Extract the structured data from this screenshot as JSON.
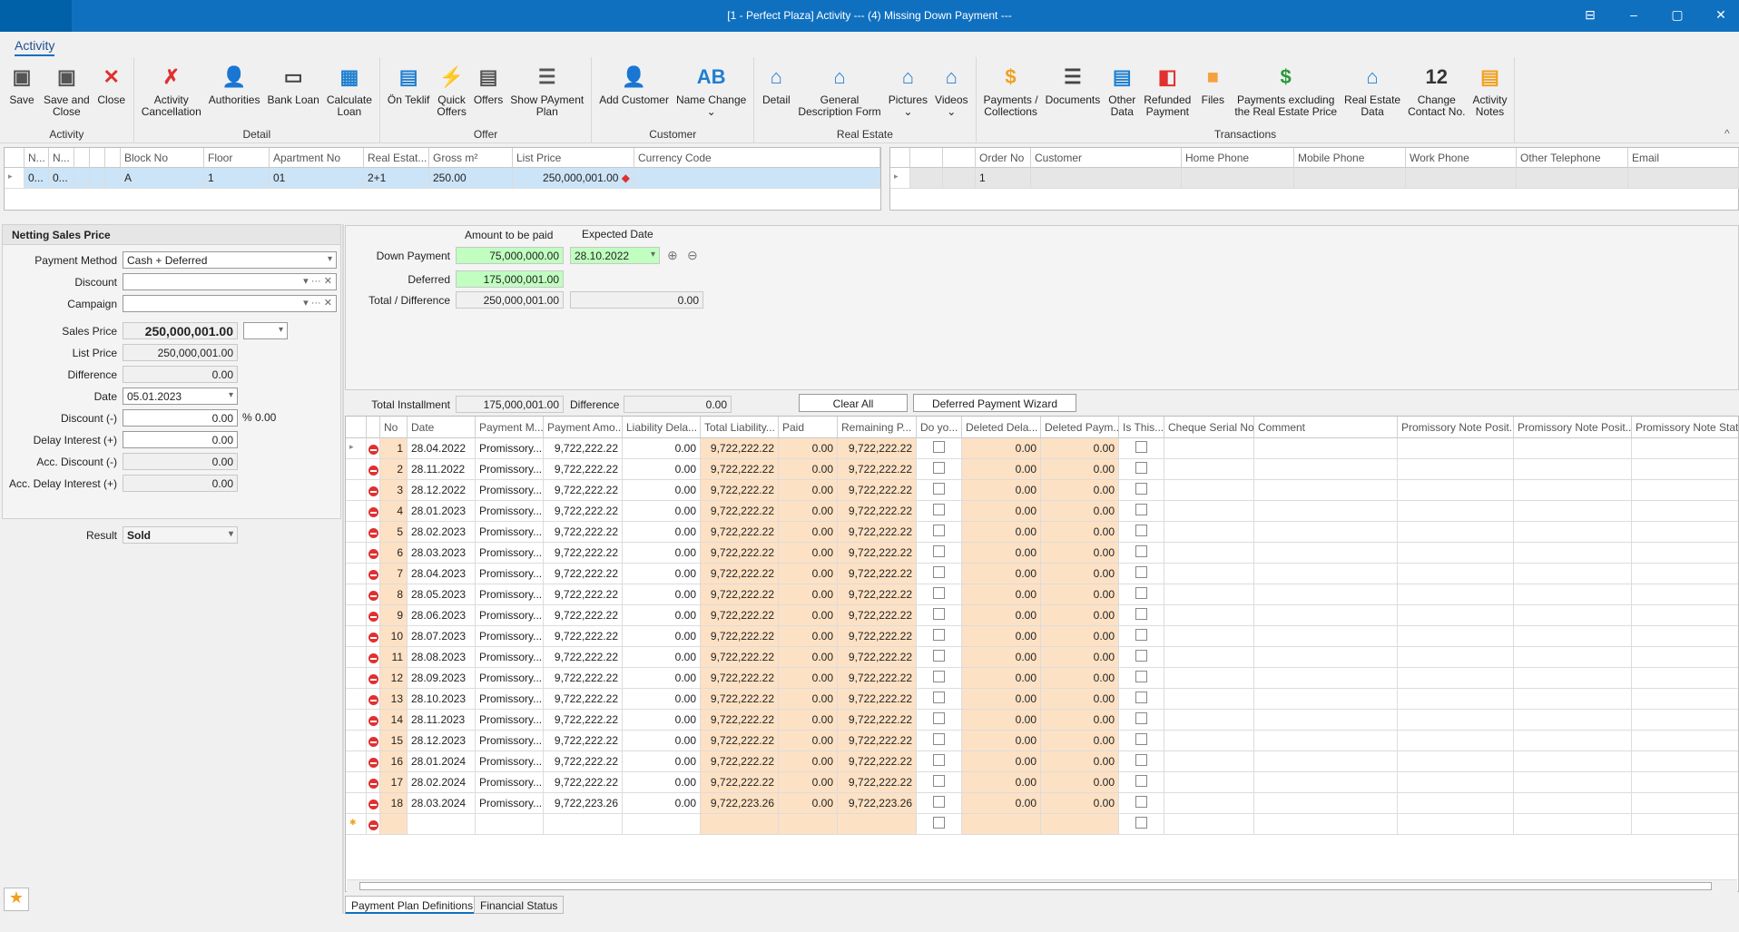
{
  "window": {
    "title": "[1 - Perfect Plaza] Activity     --- (4) Missing Down Payment ---",
    "restore_icon": "restore-icon",
    "min": "–",
    "max": "▢",
    "close": "✕"
  },
  "ribbon": {
    "tab": "Activity",
    "groups": [
      {
        "label": "Activity",
        "buttons": [
          {
            "label": "Save",
            "icon": "save-icon",
            "color": "#555",
            "glyph": "▣"
          },
          {
            "label": "Save and\nClose",
            "icon": "save-close-icon",
            "color": "#555",
            "glyph": "▣"
          },
          {
            "label": "Close",
            "icon": "close-icon",
            "color": "#e03030",
            "glyph": "✕"
          }
        ]
      },
      {
        "label": "Detail",
        "buttons": [
          {
            "label": "Activity\nCancellation",
            "icon": "cancel-document-icon",
            "color": "#e03030",
            "glyph": "✗"
          },
          {
            "label": "Authorities",
            "icon": "authorities-icon",
            "color": "#555",
            "glyph": "👤"
          },
          {
            "label": "Bank Loan",
            "icon": "card-icon",
            "color": "#444",
            "glyph": "▭"
          },
          {
            "label": "Calculate\nLoan",
            "icon": "calculator-icon",
            "color": "#1f7fd0",
            "glyph": "▦"
          }
        ]
      },
      {
        "label": "Offer",
        "buttons": [
          {
            "label": "Ön Teklif",
            "icon": "pre-offer-icon",
            "color": "#1f7fd0",
            "glyph": "▤"
          },
          {
            "label": "Quick\nOffers",
            "icon": "quick-offer-icon",
            "color": "#f0a020",
            "glyph": "⚡"
          },
          {
            "label": "Offers",
            "icon": "printer-icon",
            "color": "#555",
            "glyph": "▤"
          },
          {
            "label": "Show PAyment\nPlan",
            "icon": "payment-plan-icon",
            "color": "#555",
            "glyph": "☰"
          }
        ]
      },
      {
        "label": "Customer",
        "buttons": [
          {
            "label": "Add Customer",
            "icon": "add-customer-icon",
            "color": "#1f7fd0",
            "glyph": "👤"
          },
          {
            "label": "Name Change\n⌄",
            "icon": "name-change-icon",
            "color": "#1f7fd0",
            "glyph": "AB"
          }
        ]
      },
      {
        "label": "Real Estate",
        "buttons": [
          {
            "label": "Detail",
            "icon": "house-search-icon",
            "color": "#1f7fd0",
            "glyph": "⌂"
          },
          {
            "label": "General\nDescription Form",
            "icon": "house-info-icon",
            "color": "#1f7fd0",
            "glyph": "⌂"
          },
          {
            "label": "Pictures\n⌄",
            "icon": "house-picture-icon",
            "color": "#1f7fd0",
            "glyph": "⌂"
          },
          {
            "label": "Videos\n⌄",
            "icon": "house-video-icon",
            "color": "#1f7fd0",
            "glyph": "⌂"
          }
        ]
      },
      {
        "label": "Transactions",
        "buttons": [
          {
            "label": "Payments /\nCollections",
            "icon": "coins-icon",
            "color": "#f0a020",
            "glyph": "$"
          },
          {
            "label": "Documents",
            "icon": "document-icon",
            "color": "#444",
            "glyph": "☰"
          },
          {
            "label": "Other\nData",
            "icon": "other-data-icon",
            "color": "#1f7fd0",
            "glyph": "▤"
          },
          {
            "label": "Refunded\nPayment",
            "icon": "refund-wallet-icon",
            "color": "#e03030",
            "glyph": "◧"
          },
          {
            "label": "Files",
            "icon": "folder-icon",
            "color": "#f7a040",
            "glyph": "■"
          },
          {
            "label": "Payments excluding\nthe Real Estate Price",
            "icon": "price-tag-dollar-icon",
            "color": "#2a9a3a",
            "glyph": "$"
          },
          {
            "label": "Real Estate\nData",
            "icon": "house-coins-icon",
            "color": "#1f7fd0",
            "glyph": "⌂"
          },
          {
            "label": "Change\nContact No.",
            "icon": "number-12-icon",
            "color": "#333",
            "glyph": "12"
          },
          {
            "label": "Activity\nNotes",
            "icon": "clipboard-icon",
            "color": "#f0a020",
            "glyph": "▤"
          }
        ]
      }
    ],
    "collapse": "^"
  },
  "unit_grid": {
    "headers": [
      "N...",
      "N...",
      "",
      "",
      "",
      "Block No",
      "Floor",
      "Apartment No",
      "Real Estat...",
      "Gross m²",
      "List Price",
      "Currency Code"
    ],
    "row": [
      "0...",
      "0...",
      "",
      "",
      "",
      "A",
      "1",
      "01",
      "2+1",
      "250.00",
      "250,000,001.00",
      ""
    ]
  },
  "customer_grid": {
    "headers": [
      "",
      "",
      "",
      "Order No",
      "Customer",
      "Home Phone",
      "Mobile Phone",
      "Work Phone",
      "Other Telephone",
      "Email"
    ],
    "row": [
      "",
      "",
      "",
      "1",
      "",
      "",
      "",
      "",
      "",
      ""
    ]
  },
  "netting": {
    "title": "Netting Sales Price",
    "payment_method_label": "Payment Method",
    "payment_method": "Cash + Deferred",
    "discount_label": "Discount",
    "campaign_label": "Campaign",
    "sales_price_label": "Sales Price",
    "sales_price": "250,000,001.00",
    "list_price_label": "List Price",
    "list_price": "250,000,001.00",
    "difference_label": "Difference",
    "difference": "0.00",
    "date_label": "Date",
    "date": "05.01.2023",
    "discount_minus_label": "Discount (-)",
    "discount_minus": "0.00",
    "discount_pct": "% 0.00",
    "delay_label": "Delay Interest (+)",
    "delay": "0.00",
    "acc_discount_label": "Acc. Discount (-)",
    "acc_discount": "0.00",
    "acc_delay_label": "Acc. Delay Interest (+)",
    "acc_delay": "0.00",
    "result_label": "Result",
    "result": "Sold"
  },
  "payment": {
    "amount_header": "Amount to be paid",
    "date_header": "Expected Date",
    "down_label": "Down Payment",
    "down": "75,000,000.00",
    "down_date": "28.10.2022",
    "deferred_label": "Deferred",
    "deferred": "175,000,001.00",
    "total_label": "Total / Difference",
    "total": "250,000,001.00",
    "total_diff": "0.00",
    "installment_label": "Total Installment",
    "installment": "175,000,001.00",
    "inst_diff_label": "Difference",
    "inst_diff": "0.00",
    "clear_all": "Clear All",
    "wizard": "Deferred Payment Wizard"
  },
  "plan": {
    "headers": [
      "",
      "",
      "No",
      "Date",
      "Payment M...",
      "Payment Amo...",
      "Liability Dela...",
      "Total Liability...",
      "Paid",
      "Remaining P...",
      "Do yo...",
      "Deleted Dela...",
      "Deleted Paym...",
      "Is This...",
      "Cheque Serial No",
      "Comment",
      "Promissory Note Posit...",
      "Promissory Note Posit...",
      "Promissory Note Status"
    ],
    "rows": [
      [
        "1",
        "28.04.2022",
        "Promissory...",
        "9,722,222.22",
        "0.00",
        "9,722,222.22",
        "0.00",
        "9,722,222.22",
        "0.00",
        "0.00"
      ],
      [
        "2",
        "28.11.2022",
        "Promissory...",
        "9,722,222.22",
        "0.00",
        "9,722,222.22",
        "0.00",
        "9,722,222.22",
        "0.00",
        "0.00"
      ],
      [
        "3",
        "28.12.2022",
        "Promissory...",
        "9,722,222.22",
        "0.00",
        "9,722,222.22",
        "0.00",
        "9,722,222.22",
        "0.00",
        "0.00"
      ],
      [
        "4",
        "28.01.2023",
        "Promissory...",
        "9,722,222.22",
        "0.00",
        "9,722,222.22",
        "0.00",
        "9,722,222.22",
        "0.00",
        "0.00"
      ],
      [
        "5",
        "28.02.2023",
        "Promissory...",
        "9,722,222.22",
        "0.00",
        "9,722,222.22",
        "0.00",
        "9,722,222.22",
        "0.00",
        "0.00"
      ],
      [
        "6",
        "28.03.2023",
        "Promissory...",
        "9,722,222.22",
        "0.00",
        "9,722,222.22",
        "0.00",
        "9,722,222.22",
        "0.00",
        "0.00"
      ],
      [
        "7",
        "28.04.2023",
        "Promissory...",
        "9,722,222.22",
        "0.00",
        "9,722,222.22",
        "0.00",
        "9,722,222.22",
        "0.00",
        "0.00"
      ],
      [
        "8",
        "28.05.2023",
        "Promissory...",
        "9,722,222.22",
        "0.00",
        "9,722,222.22",
        "0.00",
        "9,722,222.22",
        "0.00",
        "0.00"
      ],
      [
        "9",
        "28.06.2023",
        "Promissory...",
        "9,722,222.22",
        "0.00",
        "9,722,222.22",
        "0.00",
        "9,722,222.22",
        "0.00",
        "0.00"
      ],
      [
        "10",
        "28.07.2023",
        "Promissory...",
        "9,722,222.22",
        "0.00",
        "9,722,222.22",
        "0.00",
        "9,722,222.22",
        "0.00",
        "0.00"
      ],
      [
        "11",
        "28.08.2023",
        "Promissory...",
        "9,722,222.22",
        "0.00",
        "9,722,222.22",
        "0.00",
        "9,722,222.22",
        "0.00",
        "0.00"
      ],
      [
        "12",
        "28.09.2023",
        "Promissory...",
        "9,722,222.22",
        "0.00",
        "9,722,222.22",
        "0.00",
        "9,722,222.22",
        "0.00",
        "0.00"
      ],
      [
        "13",
        "28.10.2023",
        "Promissory...",
        "9,722,222.22",
        "0.00",
        "9,722,222.22",
        "0.00",
        "9,722,222.22",
        "0.00",
        "0.00"
      ],
      [
        "14",
        "28.11.2023",
        "Promissory...",
        "9,722,222.22",
        "0.00",
        "9,722,222.22",
        "0.00",
        "9,722,222.22",
        "0.00",
        "0.00"
      ],
      [
        "15",
        "28.12.2023",
        "Promissory...",
        "9,722,222.22",
        "0.00",
        "9,722,222.22",
        "0.00",
        "9,722,222.22",
        "0.00",
        "0.00"
      ],
      [
        "16",
        "28.01.2024",
        "Promissory...",
        "9,722,222.22",
        "0.00",
        "9,722,222.22",
        "0.00",
        "9,722,222.22",
        "0.00",
        "0.00"
      ],
      [
        "17",
        "28.02.2024",
        "Promissory...",
        "9,722,222.22",
        "0.00",
        "9,722,222.22",
        "0.00",
        "9,722,222.22",
        "0.00",
        "0.00"
      ],
      [
        "18",
        "28.03.2024",
        "Promissory...",
        "9,722,223.26",
        "0.00",
        "9,722,223.26",
        "0.00",
        "9,722,223.26",
        "0.00",
        "0.00"
      ]
    ]
  },
  "tabs": [
    "Payment Plan Definitions",
    "Financial Status"
  ],
  "colors": {
    "accent": "#1070c0",
    "highlight_row": "#cce4f7",
    "computed_cell": "#fde1c4",
    "editable_green": "#c0ffc0"
  }
}
